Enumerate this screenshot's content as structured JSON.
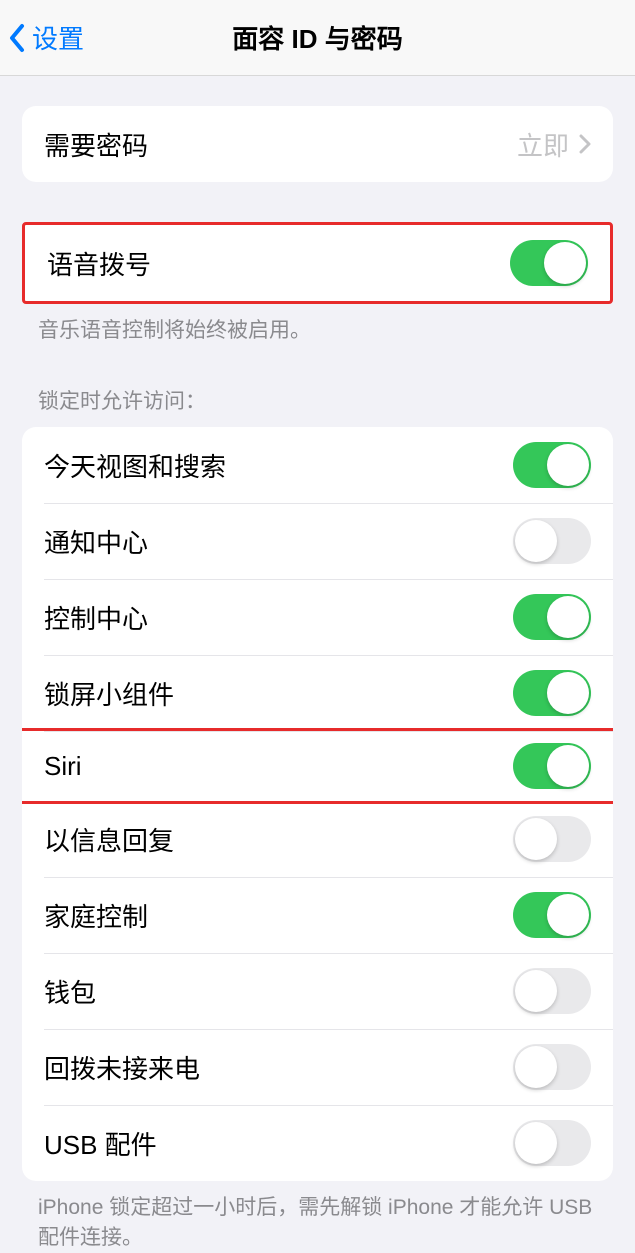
{
  "navbar": {
    "back_label": "设置",
    "title": "面容 ID 与密码"
  },
  "require_passcode": {
    "label": "需要密码",
    "value": "立即"
  },
  "voice_dial": {
    "label": "语音拨号",
    "enabled": true,
    "footer": "音乐语音控制将始终被启用。"
  },
  "lock_access": {
    "header": "锁定时允许访问：",
    "items": [
      {
        "label": "今天视图和搜索",
        "enabled": true,
        "highlighted": false
      },
      {
        "label": "通知中心",
        "enabled": false,
        "highlighted": false
      },
      {
        "label": "控制中心",
        "enabled": true,
        "highlighted": false
      },
      {
        "label": "锁屏小组件",
        "enabled": true,
        "highlighted": false
      },
      {
        "label": "Siri",
        "enabled": true,
        "highlighted": true
      },
      {
        "label": "以信息回复",
        "enabled": false,
        "highlighted": false
      },
      {
        "label": "家庭控制",
        "enabled": true,
        "highlighted": false
      },
      {
        "label": "钱包",
        "enabled": false,
        "highlighted": false
      },
      {
        "label": "回拨未接来电",
        "enabled": false,
        "highlighted": false
      },
      {
        "label": "USB 配件",
        "enabled": false,
        "highlighted": false
      }
    ],
    "footer": "iPhone 锁定超过一小时后，需先解锁 iPhone 才能允许 USB 配件连接。"
  }
}
